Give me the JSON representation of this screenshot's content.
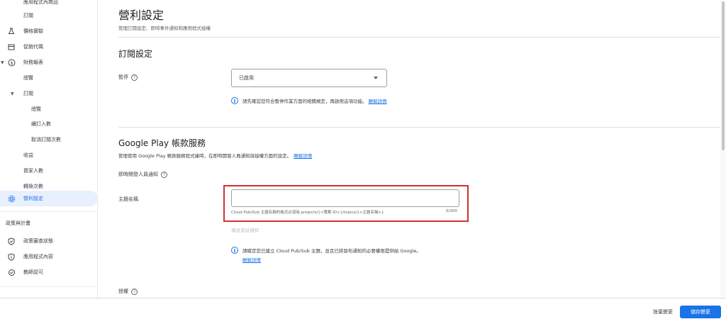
{
  "sidebar": {
    "items": [
      {
        "label": "應用程式內商品",
        "icon": ""
      },
      {
        "label": "訂閱",
        "icon": ""
      },
      {
        "label": "價格實驗",
        "icon": "flask-icon"
      },
      {
        "label": "促銷代碼",
        "icon": "storefront-icon"
      },
      {
        "label": "財務報表",
        "icon": "dollar-circle-icon"
      },
      {
        "label": "總覽",
        "icon": ""
      },
      {
        "label": "訂閱",
        "icon": ""
      },
      {
        "label": "總覽",
        "icon": ""
      },
      {
        "label": "續訂入數",
        "icon": ""
      },
      {
        "label": "取消訂閱次數",
        "icon": ""
      },
      {
        "label": "收益",
        "icon": ""
      },
      {
        "label": "買家人數",
        "icon": ""
      },
      {
        "label": "轉換次數",
        "icon": ""
      },
      {
        "label": "營利設定",
        "icon": "gear-icon"
      },
      {
        "label": "政策與計畫",
        "icon": ""
      },
      {
        "label": "政策審查狀態",
        "icon": "shield-check-icon"
      },
      {
        "label": "應用程式內容",
        "icon": "shield-info-icon"
      },
      {
        "label": "教師認可",
        "icon": "badge-icon"
      }
    ]
  },
  "main": {
    "title": "營利設定",
    "subtitle": "管理訂閱設定、即時事件通知和應用程式授權",
    "subscription_section": {
      "title": "訂閱設定",
      "pause_label": "暫停",
      "pause_value": "已啟用",
      "pause_info": "請先確認您符合暫停作業方面的相關規定，再啟用這項功能。",
      "learn_more": "瞭解詳情"
    },
    "gp_section": {
      "title": "Google Play 帳款服務",
      "description": "管理使用 Google Play 帳款服務程式庫時，在即時開發人員通知與授權方面的設定。",
      "learn_more": "瞭解詳情",
      "rtdn_label": "即時開發人員通知",
      "topic_label": "主題名稱",
      "topic_value": "",
      "topic_hint": "Cloud Pub/Sub 主題名稱的格式必須為 projects/{<專案 ID>}/topics/{<主題名稱>}",
      "topic_count": "0/300",
      "send_test": "傳送測試通知",
      "pubsub_info": "請確定您已建立 Cloud Pub/Sub 主題，並且已將發布通知的必要權限提供給 Google。",
      "pubsub_learn_more": "瞭解詳情",
      "license_label": "授權"
    }
  },
  "footer": {
    "discard": "捨棄變更",
    "save": "儲存變更"
  },
  "colors": {
    "accent": "#1a73e8",
    "highlight": "#d32f2f",
    "active_bg": "#e8f0fe"
  }
}
